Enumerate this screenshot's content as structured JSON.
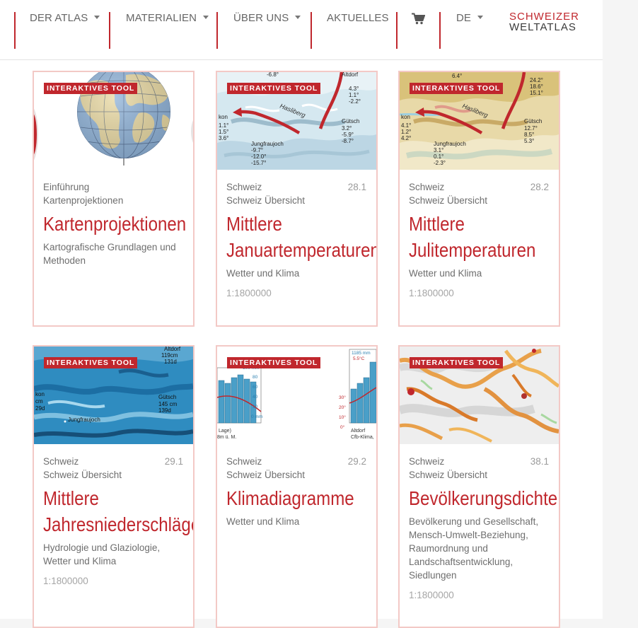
{
  "nav": {
    "items": [
      {
        "label": "DER ATLAS",
        "caret": true
      },
      {
        "label": "MATERIALIEN",
        "caret": true
      },
      {
        "label": "ÜBER UNS",
        "caret": true
      },
      {
        "label": "AKTUELLES",
        "caret": false
      },
      {
        "label": "DE",
        "caret": true
      }
    ],
    "cart_icon": "cart-icon",
    "brand_line1": "SCHWEIZER",
    "brand_line2": "WELTATLAS"
  },
  "colors": {
    "accent": "#c0272d",
    "card_border": "#f3c9c6"
  },
  "cards": [
    {
      "badge": "INTERAKTIVES TOOL",
      "cat1": "Einführung",
      "cat2": "Kartenprojektionen",
      "number": "",
      "title1": "Kartenprojektionen",
      "title2": "",
      "desc": "Kartografische Grundlagen und Methoden",
      "scale": "",
      "image": "globe"
    },
    {
      "badge": "INTERAKTIVES TOOL",
      "cat1": "Schweiz",
      "cat2": "Schweiz Übersicht",
      "number": "28.1",
      "title1": "Mittlere",
      "title2": "Januartemperaturen",
      "desc": "Wetter und Klima",
      "scale": "1:1800000",
      "image": "temperature-map-january"
    },
    {
      "badge": "INTERAKTIVES TOOL",
      "cat1": "Schweiz",
      "cat2": "Schweiz Übersicht",
      "number": "28.2",
      "title1": "Mittlere",
      "title2": "Julitemperaturen",
      "desc": "Wetter und Klima",
      "scale": "1:1800000",
      "image": "temperature-map-july"
    },
    {
      "badge": "INTERAKTIVES TOOL",
      "cat1": "Schweiz",
      "cat2": "Schweiz Übersicht",
      "number": "29.1",
      "title1": "Mittlere",
      "title2": "Jahresniederschläge",
      "desc": "Hydrologie und Glaziologie, Wetter und Klima",
      "scale": "1:1800000",
      "image": "precipitation-map"
    },
    {
      "badge": "INTERAKTIVES TOOL",
      "cat1": "Schweiz",
      "cat2": "Schweiz Übersicht",
      "number": "29.2",
      "title1": "Klimadiagramme",
      "title2": "",
      "desc": "Wetter und Klima",
      "scale": "",
      "image": "climate-diagram"
    },
    {
      "badge": "INTERAKTIVES TOOL",
      "cat1": "Schweiz",
      "cat2": "Schweiz Übersicht",
      "number": "38.1",
      "title1": "Bevölkerungsdichte",
      "title2": "",
      "desc": "Bevölkerung und Gesellschaft, Mensch-Umwelt-Beziehung, Raumordnung und Landschaftsentwicklung, Siedlungen",
      "scale": "1:1800000",
      "image": "population-density-map"
    }
  ],
  "thumbnail_text": {
    "jan": [
      "-6.8°",
      "4.3°",
      "1.1°",
      "-2.2°",
      "Gütsch",
      "3.2°",
      "-5.9°",
      "-8.7°",
      "Jungfraujoch",
      "-9.7°",
      "-12.0°",
      "-15.7°",
      "kon",
      "1.1°",
      "1.5°",
      "3.6°",
      "Hasliberg",
      "Altdorf"
    ],
    "jul": [
      "6.4°",
      "24.2°",
      "18.6°",
      "15.1°",
      "Gütsch",
      "12.7°",
      "8.5°",
      "5.3°",
      "Jungfraujoch",
      "3.1°",
      "0.1°",
      "-2.3°",
      "kon",
      "4.1°",
      "1.2°",
      "4.2°",
      "Hasliberg"
    ],
    "precip": [
      "Altdorf",
      "119cm",
      "131d",
      "Gütsch",
      "145 cm",
      "139d",
      "Jungfraujoch",
      "kon",
      "cm",
      "29d"
    ],
    "climate": [
      "1185 mm",
      "5.5°C",
      "100 mm",
      "80",
      "60",
      "40",
      "20",
      "0 mm",
      "30°",
      "20°",
      "10°",
      "0°",
      "Lage)",
      "8m ü. M.",
      "Altdorf",
      "Cfb-Klima,"
    ]
  }
}
